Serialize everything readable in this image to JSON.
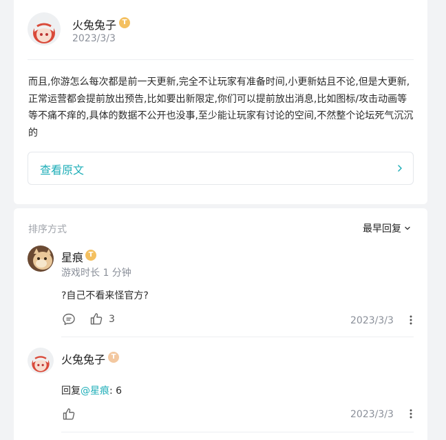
{
  "post": {
    "author": "火兔兔子",
    "badge": "T",
    "date": "2023/3/3",
    "body_lines": [
      "而且,你游怎么每次都是前一天更新,完全不让玩家有准备时间,小更新姑且不论,但是大更新,",
      "正常运营都会提前放出预告,比如要出新限定,你们可以提前放出消息,比如图标/攻击动画等",
      "等不痛不痒的,具体的数据不公开也没事,至少能让玩家有讨论的空间,不然整个论坛死气沉沉",
      "的"
    ],
    "view_original": "查看原文",
    "view_original_icon": "chevron-right-icon"
  },
  "comments": {
    "sort_label": "排序方式",
    "sort_value": "最早回复",
    "items": [
      {
        "author": "星痕",
        "badge": "T",
        "meta": "游戏时长 1 分钟",
        "text": "?自己不看来怪官方?",
        "likes": "3",
        "date": "2023/3/3"
      },
      {
        "author": "火兔兔子",
        "badge": "T",
        "reply_prefix": "回复",
        "reply_to": "@星痕",
        "reply_text": ": 6",
        "date": "2023/3/3"
      }
    ]
  },
  "colors": {
    "accent": "#1eaeb8",
    "badge": "#f4c060"
  }
}
